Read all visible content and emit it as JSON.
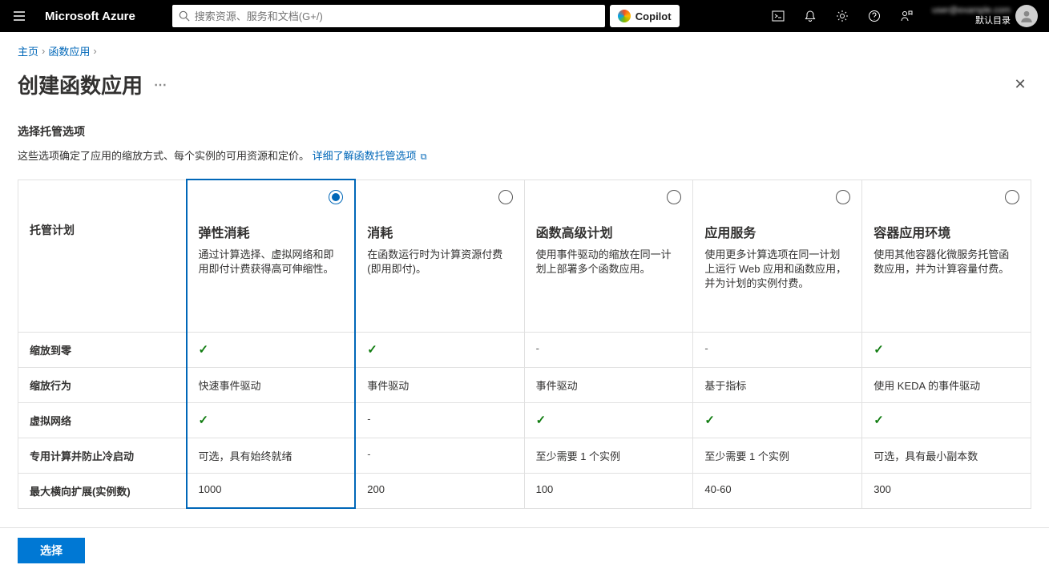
{
  "header": {
    "brand": "Microsoft Azure",
    "search_placeholder": "搜索资源、服务和文档(G+/)",
    "copilot_label": "Copilot",
    "user_line2": "默认目录"
  },
  "breadcrumb": {
    "home": "主页",
    "item": "函数应用"
  },
  "page": {
    "title": "创建函数应用"
  },
  "section": {
    "heading": "选择托管选项",
    "desc_prefix": "这些选项确定了应用的缩放方式、每个实例的可用资源和定价。",
    "link_text": "详细了解函数托管选项"
  },
  "row_headers": {
    "plan_title": "托管计划",
    "scale_zero": "缩放到零",
    "scale_behavior": "缩放行为",
    "vnet": "虚拟网络",
    "dedicated": "专用计算并防止冷启动",
    "max_scale": "最大横向扩展(实例数)"
  },
  "plans": [
    {
      "name": "弹性消耗",
      "desc": "通过计算选择、虚拟网络和即用即付计费获得高可伸缩性。",
      "selected": true,
      "scale_zero": "check",
      "scale_behavior": "快速事件驱动",
      "vnet": "check",
      "dedicated": "可选，具有始终就绪",
      "max_scale": "1000"
    },
    {
      "name": "消耗",
      "desc": "在函数运行时为计算资源付费(即用即付)。",
      "selected": false,
      "scale_zero": "check",
      "scale_behavior": "事件驱动",
      "vnet": "dash",
      "dedicated": "-",
      "max_scale": "200"
    },
    {
      "name": "函数高级计划",
      "desc": "使用事件驱动的缩放在同一计划上部署多个函数应用。",
      "selected": false,
      "scale_zero": "dash",
      "scale_behavior": "事件驱动",
      "vnet": "check",
      "dedicated": "至少需要 1 个实例",
      "max_scale": "100"
    },
    {
      "name": "应用服务",
      "desc": "使用更多计算选项在同一计划上运行 Web 应用和函数应用，并为计划的实例付费。",
      "selected": false,
      "scale_zero": "dash",
      "scale_behavior": "基于指标",
      "vnet": "check",
      "dedicated": "至少需要 1 个实例",
      "max_scale": "40-60"
    },
    {
      "name": "容器应用环境",
      "desc": "使用其他容器化微服务托管函数应用，并为计算容量付费。",
      "selected": false,
      "scale_zero": "check",
      "scale_behavior": "使用 KEDA 的事件驱动",
      "vnet": "check",
      "dedicated": "可选，具有最小副本数",
      "max_scale": "300"
    }
  ],
  "footer": {
    "select_label": "选择"
  }
}
